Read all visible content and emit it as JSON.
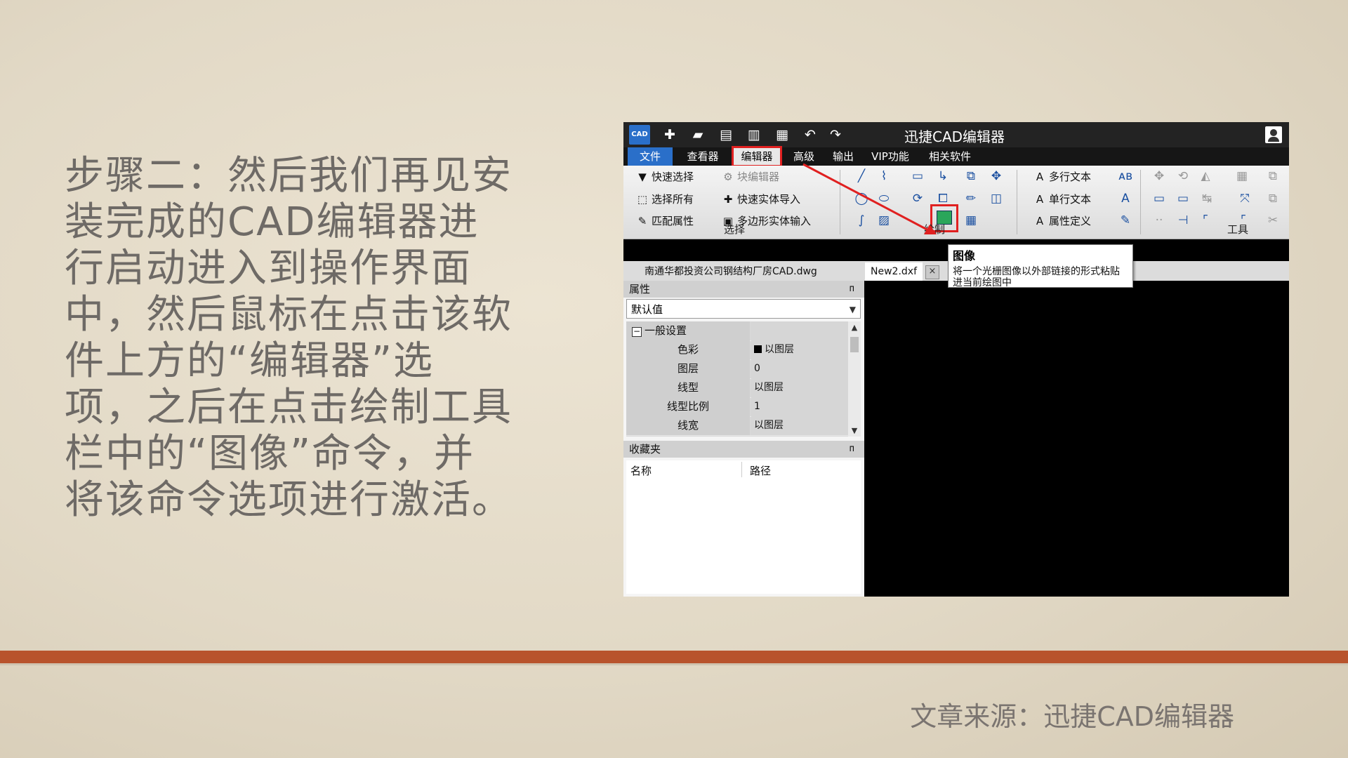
{
  "slide": {
    "text": "步骤二：然后我们再见安装完成的CAD编辑器进行启动进入到操作界面中，然后鼠标在点击该软件上方的“编辑器”选项，之后在点击绘制工具栏中的“图像”命令，并将该命令选项进行激活。",
    "source": "文章来源：迅捷CAD编辑器"
  },
  "window": {
    "title": "迅捷CAD编辑器",
    "logo": "CAD"
  },
  "quick_access": [
    "new-icon",
    "open-folder-icon",
    "save-icon",
    "save-as-icon",
    "print-icon",
    "undo-icon",
    "redo-icon"
  ],
  "menu": {
    "file": "文件",
    "viewer": "查看器",
    "editor": "编辑器",
    "advanced": "高级",
    "output": "输出",
    "vip": "VIP功能",
    "related": "相关软件"
  },
  "ribbon": {
    "select": {
      "quick_select": "快速选择",
      "select_all": "选择所有",
      "match_props": "匹配属性",
      "block_editor": "块编辑器",
      "quick_import": "快速实体导入",
      "polygon_input": "多边形实体输入",
      "label": "选择"
    },
    "draw_label": "绘制",
    "text": {
      "mtext": "多行文本",
      "stext": "单行文本",
      "attdef": "属性定义"
    },
    "tools_label": "工具"
  },
  "tooltip": {
    "title": "图像",
    "desc": "将一个光栅图像以外部链接的形式粘贴进当前绘图中"
  },
  "doc_tabs": {
    "tab1": "南通华都投资公司钢结构厂房CAD.dwg",
    "tab2": "New2.dxf",
    "close": "×"
  },
  "properties": {
    "title": "属性",
    "pin": "ᴨ",
    "dropdown": "默认值",
    "section": "一般设置",
    "section_toggle": "−",
    "rows": [
      {
        "name": "色彩",
        "value": "以图层"
      },
      {
        "name": "图层",
        "value": "0"
      },
      {
        "name": "线型",
        "value": "以图层"
      },
      {
        "name": "线型比例",
        "value": "1"
      },
      {
        "name": "线宽",
        "value": "以图层"
      }
    ]
  },
  "favorites": {
    "title": "收藏夹",
    "col_name": "名称",
    "col_path": "路径"
  },
  "colors": {
    "accent_blue": "#2a6fc9",
    "highlight_red": "#e02020",
    "band": "#b8532c"
  }
}
